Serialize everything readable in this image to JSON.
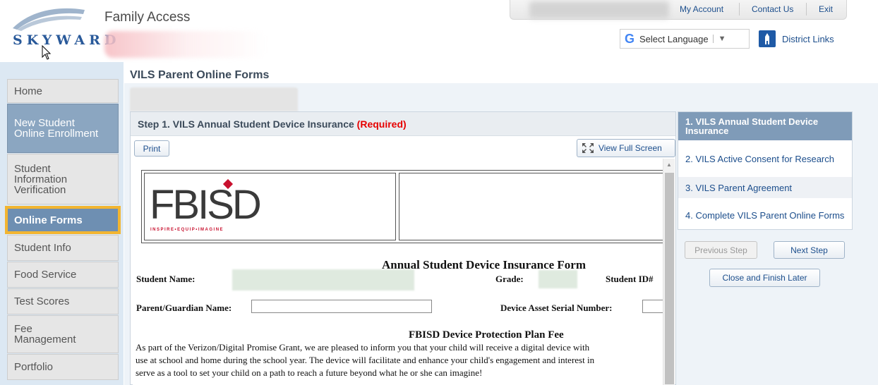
{
  "header": {
    "logo_text": "SKYWARD",
    "app_title": "Family Access",
    "links": [
      "My Account",
      "Contact Us",
      "Exit"
    ],
    "language_label": "Select Language",
    "language_icon": "google-g-icon",
    "district_links": "District Links"
  },
  "sidebar": {
    "items": [
      {
        "label": "Home"
      },
      {
        "label": "New Student Online Enrollment"
      },
      {
        "label": "Student Information Verification"
      },
      {
        "label": "Online Forms"
      },
      {
        "label": "Student Info"
      },
      {
        "label": "Food Service"
      },
      {
        "label": "Test Scores"
      },
      {
        "label": "Fee Management"
      },
      {
        "label": "Portfolio"
      }
    ]
  },
  "main": {
    "page_title": "VILS Parent Online Forms",
    "step_title": "Step 1. VILS Annual Student Device Insurance",
    "required": "(Required)",
    "print_label": "Print",
    "fullscreen_label": "View Full Screen",
    "document": {
      "logo": "FBISD",
      "tagline": "INSPIRE•EQUIP•IMAGINE",
      "form_title": "Annual Student Device Insurance Form",
      "student_name_label": "Student Name:",
      "grade_label": "Grade:",
      "student_id_label": "Student ID#",
      "parent_label": "Parent/Guardian Name:",
      "serial_label": "Device Asset Serial Number:",
      "fee_title": "FBISD Device Protection Plan Fee",
      "paragraph_lines": [
        "As part of the Verizon/Digital Promise Grant, we are pleased to inform you that your child will receive a digital device with",
        "use at school and home during the school year. The device will facilitate and enhance your child's engagement and interest in",
        "serve as a tool to set your child on a path to reach a future beyond what he or she can imagine!"
      ]
    }
  },
  "steps_panel": {
    "steps": [
      {
        "label": "1. VILS Annual Student Device Insurance"
      },
      {
        "label": "2. VILS Active Consent for Research"
      },
      {
        "label": "3. VILS Parent Agreement"
      },
      {
        "label": "4. Complete VILS Parent Online Forms"
      }
    ],
    "previous_label": "Previous Step",
    "next_label": "Next Step",
    "close_label": "Close and Finish Later"
  },
  "colors": {
    "link": "#1c4e8c",
    "required": "#e60000",
    "highlight": "#f2b531",
    "active_nav": "#8ba6c1"
  }
}
